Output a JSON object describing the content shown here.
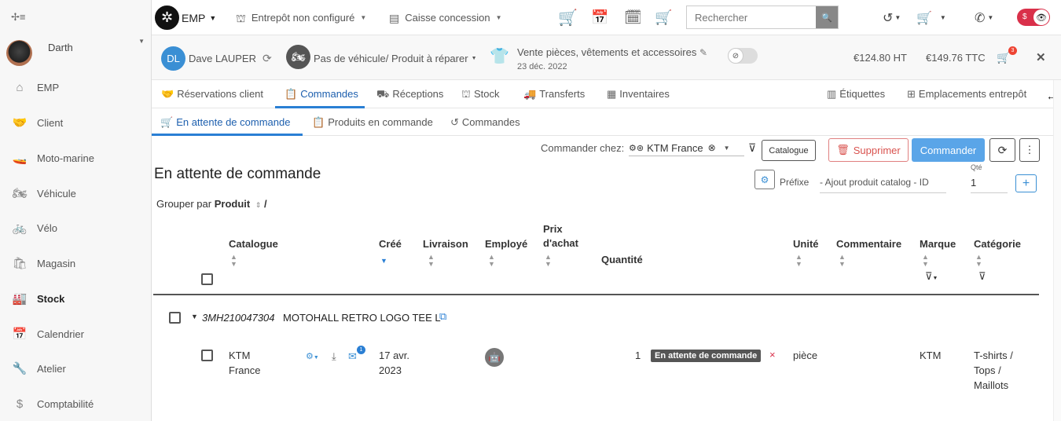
{
  "sidebar": {
    "user": "Darth",
    "items": [
      {
        "label": "EMP",
        "icon": "home-icon",
        "glyph": "⌂"
      },
      {
        "label": "Client",
        "icon": "handshake-icon",
        "glyph": "🤝"
      },
      {
        "label": "Moto-marine",
        "icon": "jetski-icon",
        "glyph": "🚤"
      },
      {
        "label": "Véhicule",
        "icon": "motorcycle-icon",
        "glyph": "🏍"
      },
      {
        "label": "Vélo",
        "icon": "bicycle-icon",
        "glyph": "🚲"
      },
      {
        "label": "Magasin",
        "icon": "shop-icon",
        "glyph": "🛍"
      },
      {
        "label": "Stock",
        "icon": "warehouse-icon",
        "glyph": "🏭"
      },
      {
        "label": "Calendrier",
        "icon": "calendar-icon",
        "glyph": "📅"
      },
      {
        "label": "Atelier",
        "icon": "wrench-icon",
        "glyph": "🔧"
      },
      {
        "label": "Comptabilité",
        "icon": "dollar-icon",
        "glyph": "$"
      }
    ]
  },
  "topbar": {
    "app": "EMP",
    "warehouse": "Entrepôt non configuré",
    "register": "Caisse concession",
    "search_placeholder": "Rechercher"
  },
  "context": {
    "initials": "DL",
    "customer": "Dave LAUPER",
    "vehicle": "Pas de véhicule/ Produit à réparer",
    "sale_type": "Vente pièces, vêtements et accessoires",
    "date": "23 déc. 2022",
    "total_ht": "€124.80 HT",
    "total_ttc": "€149.76 TTC",
    "cart_count": "3"
  },
  "tabs": [
    "Réservations client",
    "Commandes",
    "Réceptions",
    "Stock",
    "Transferts",
    "Inventaires"
  ],
  "tabs_right": [
    "Étiquettes",
    "Emplacements entrepôt"
  ],
  "subtabs": [
    "En attente de commande",
    "Produits en commande",
    "Commandes"
  ],
  "toolbar": {
    "order_from_label": "Commander chez:",
    "supplier": "KTM France",
    "catalogue": "Catalogue",
    "delete": "Supprimer",
    "order": "Commander"
  },
  "page": {
    "title": "En attente de commande",
    "group_label": "Grouper par",
    "group_value": "Produit",
    "prefix": "Préfixe",
    "add_catalog": "- Ajout produit catalog - ID",
    "qty_label": "Qté",
    "qty_value": "1"
  },
  "table": {
    "headers": {
      "catalogue": "Catalogue",
      "created": "Créé",
      "delivery": "Livraison",
      "employee": "Employé",
      "price": "Prix d'achat",
      "quantity": "Quantité",
      "unit": "Unité",
      "comment": "Commentaire",
      "brand": "Marque",
      "category": "Catégorie"
    },
    "group": {
      "ref": "3MH210047304",
      "name": "MOTOHALL RETRO LOGO TEE L"
    },
    "row": {
      "catalogue": "KTM France",
      "created": "17 avr. 2023",
      "quantity": "1",
      "status": "En attente de commande",
      "unit": "pièce",
      "brand": "KTM",
      "category": "T-shirts / Tops / Maillots",
      "doc_badge": "1"
    }
  }
}
